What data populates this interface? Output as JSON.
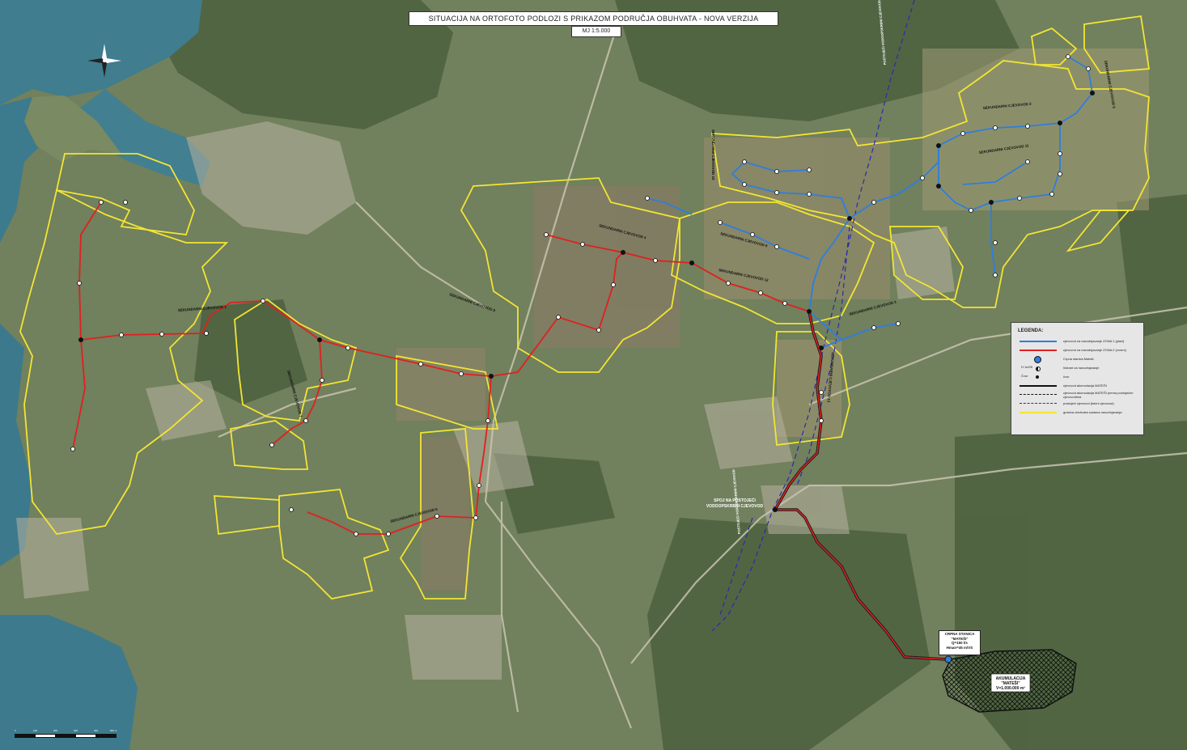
{
  "header": {
    "title": "SITUACIJA NA ORTOFOTO PODLOZI S PRIKAZOM PODRUČJA OBUHVATA - NOVA VERZIJA",
    "scale": "MJ 1:5.000"
  },
  "colors": {
    "zone1_pipe": "#2f7de0",
    "zone2_pipe": "#e02020",
    "boundary": "#f2e534",
    "existing_pipe": "#2a2ab0",
    "reservoir": "#2d3a2d"
  },
  "legend": {
    "title": "LEGENDA:",
    "items": [
      {
        "symbol": "blue-line-icon",
        "text": "cjevovod za navodnjavanje ZONA 1 (plavi)"
      },
      {
        "symbol": "red-line-icon",
        "text": "cjevovod za navodnjavanje ZONA 2 (crveni)"
      },
      {
        "symbol": "pump-station-icon",
        "text": "Crpna stanica Mateši"
      },
      {
        "symbol": "hydrant-icon",
        "label": "H 1e/09",
        "text": "hidrant za navodnjavanje"
      },
      {
        "symbol": "node-icon",
        "label": "Čvor",
        "text": "čvor"
      },
      {
        "symbol": "black-line-icon",
        "text": "cjevovod akumulacija MATEŠI"
      },
      {
        "symbol": "black-dash-icon",
        "text": "cjevovod akumulacija MATEŠI prema postojećim cjevovodima"
      },
      {
        "symbol": "navy-dash-icon",
        "text": "postojeći cjevovod (tlačni cjevovod)"
      },
      {
        "symbol": "yellow-line-icon",
        "text": "granica obuhvata sustava navodnjavanja"
      }
    ]
  },
  "labels": {
    "reservoir": [
      "AKUMULACIJA",
      "\"MATEŠI\"",
      "V=1.000.000 m³"
    ],
    "pump_station": [
      "CRPNA STANICA",
      "\"MATEŠI\"",
      "Q=150 l/s",
      "Hman=45 m/VS"
    ],
    "connection": [
      "SPOJ NA POSTOJEĆI",
      "VODOOPSKRBNI CJEVOVOD"
    ],
    "pipelines": [
      "SEKUNDARNI CJEVOVOD 1",
      "SEKUNDARNI CJEVOVOD 2",
      "SEKUNDARNI CJEVOVOD 3",
      "SEKUNDARNI CJEVOVOD 4",
      "SEKUNDARNI CJEVOVOD 5",
      "SEKUNDARNI CJEVOVOD 6",
      "SEKUNDARNI CJEVOVOD 7",
      "SEKUNDARNI CJEVOVOD 8",
      "SEKUNDARNI CJEVOVOD 9",
      "SEKUNDARNI CJEVOVOD 10",
      "SEKUNDARNI CJEVOVOD 11",
      "SEKUNDARNI CJEVOVOD 12",
      "SEKUNDARNI CJEVOVOD 13"
    ],
    "existing": [
      "POSTOJEĆI VODOOPSKRBNI CJEVOVOD",
      "POSTOJEĆI VODOOPSKRBNI CJEVOVOD"
    ]
  },
  "scalebar": {
    "labels": [
      "0",
      "100",
      "200",
      "300",
      "400",
      "500 m"
    ]
  }
}
